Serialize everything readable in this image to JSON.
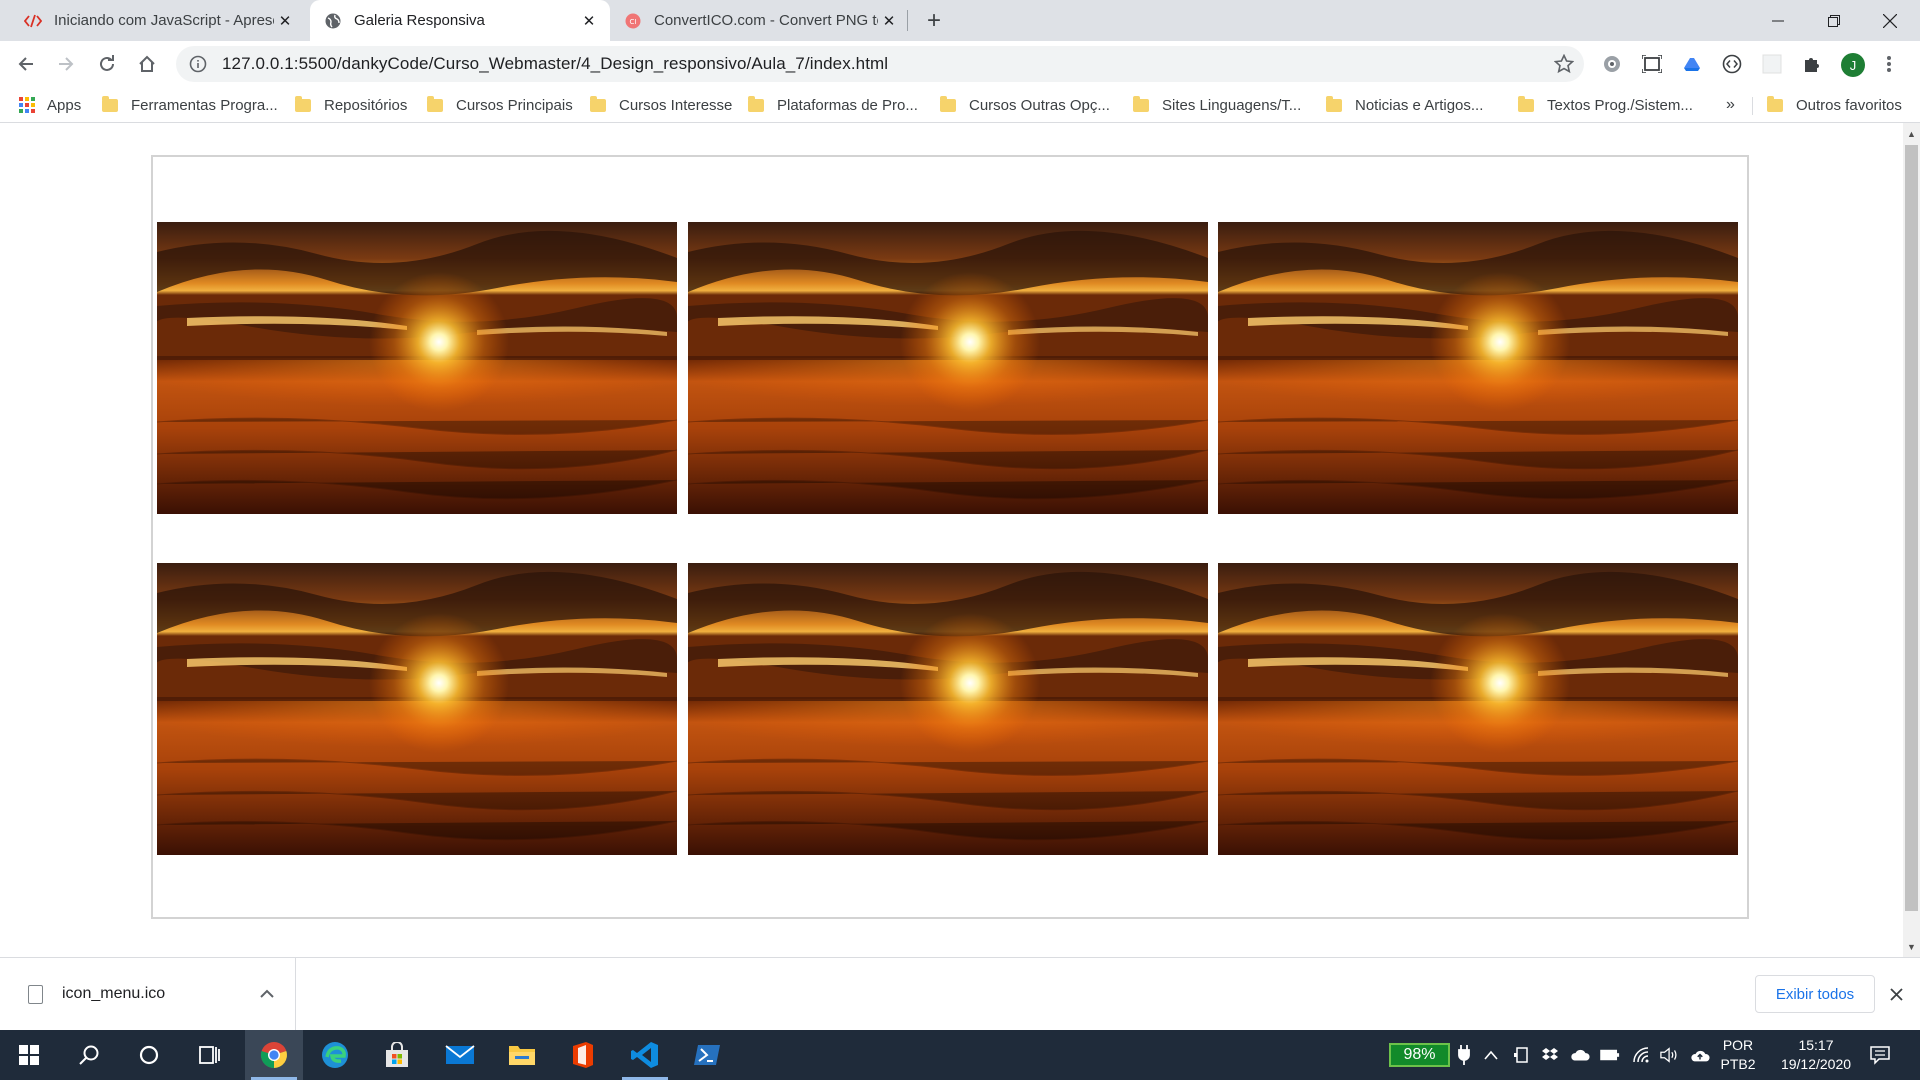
{
  "browser": {
    "tabs": [
      {
        "title": "Iniciando com JavaScript - Apresentação",
        "favicon": "code-icon",
        "active": false
      },
      {
        "title": "Galeria Responsiva",
        "favicon": "globe-icon",
        "active": true
      },
      {
        "title": "ConvertICO.com - Convert PNG to ICO",
        "favicon": "converticon-icon",
        "active": false
      }
    ],
    "new_tab_label": "+",
    "url": "127.0.0.1:5500/dankyCode/Curso_Webmaster/4_Design_responsivo/Aula_7/index.html",
    "profile_initial": "J",
    "bookmarks": {
      "apps_label": "Apps",
      "items": [
        "Ferramentas Progra...",
        "Repositórios",
        "Cursos Principais",
        "Cursos Interesse",
        "Plataformas de Pro...",
        "Cursos Outras Opç...",
        "Sites Linguagens/T...",
        "Noticias e Artigos...",
        "Textos Prog./Sistem..."
      ],
      "more_label": "»",
      "other_label": "Outros favoritos"
    }
  },
  "page": {
    "gallery": {
      "images": [
        {
          "subject": "sunset over golden field"
        },
        {
          "subject": "sunset over golden field"
        },
        {
          "subject": "sunset over golden field"
        },
        {
          "subject": "sunset over golden field"
        },
        {
          "subject": "sunset over golden field"
        },
        {
          "subject": "sunset over golden field"
        }
      ]
    }
  },
  "download_bar": {
    "file_name": "icon_menu.ico",
    "show_all_label": "Exibir todos"
  },
  "taskbar": {
    "battery_label": "98%",
    "lang_line1": "POR",
    "lang_line2": "PTB2",
    "time": "15:17",
    "date": "19/12/2020"
  },
  "colors": {
    "tabstrip": "#dee1e6",
    "accent_link": "#1a73e8",
    "taskbar": "#1f2b3a",
    "battery": "#128a2a",
    "sunset_orange": "#e0620a"
  }
}
